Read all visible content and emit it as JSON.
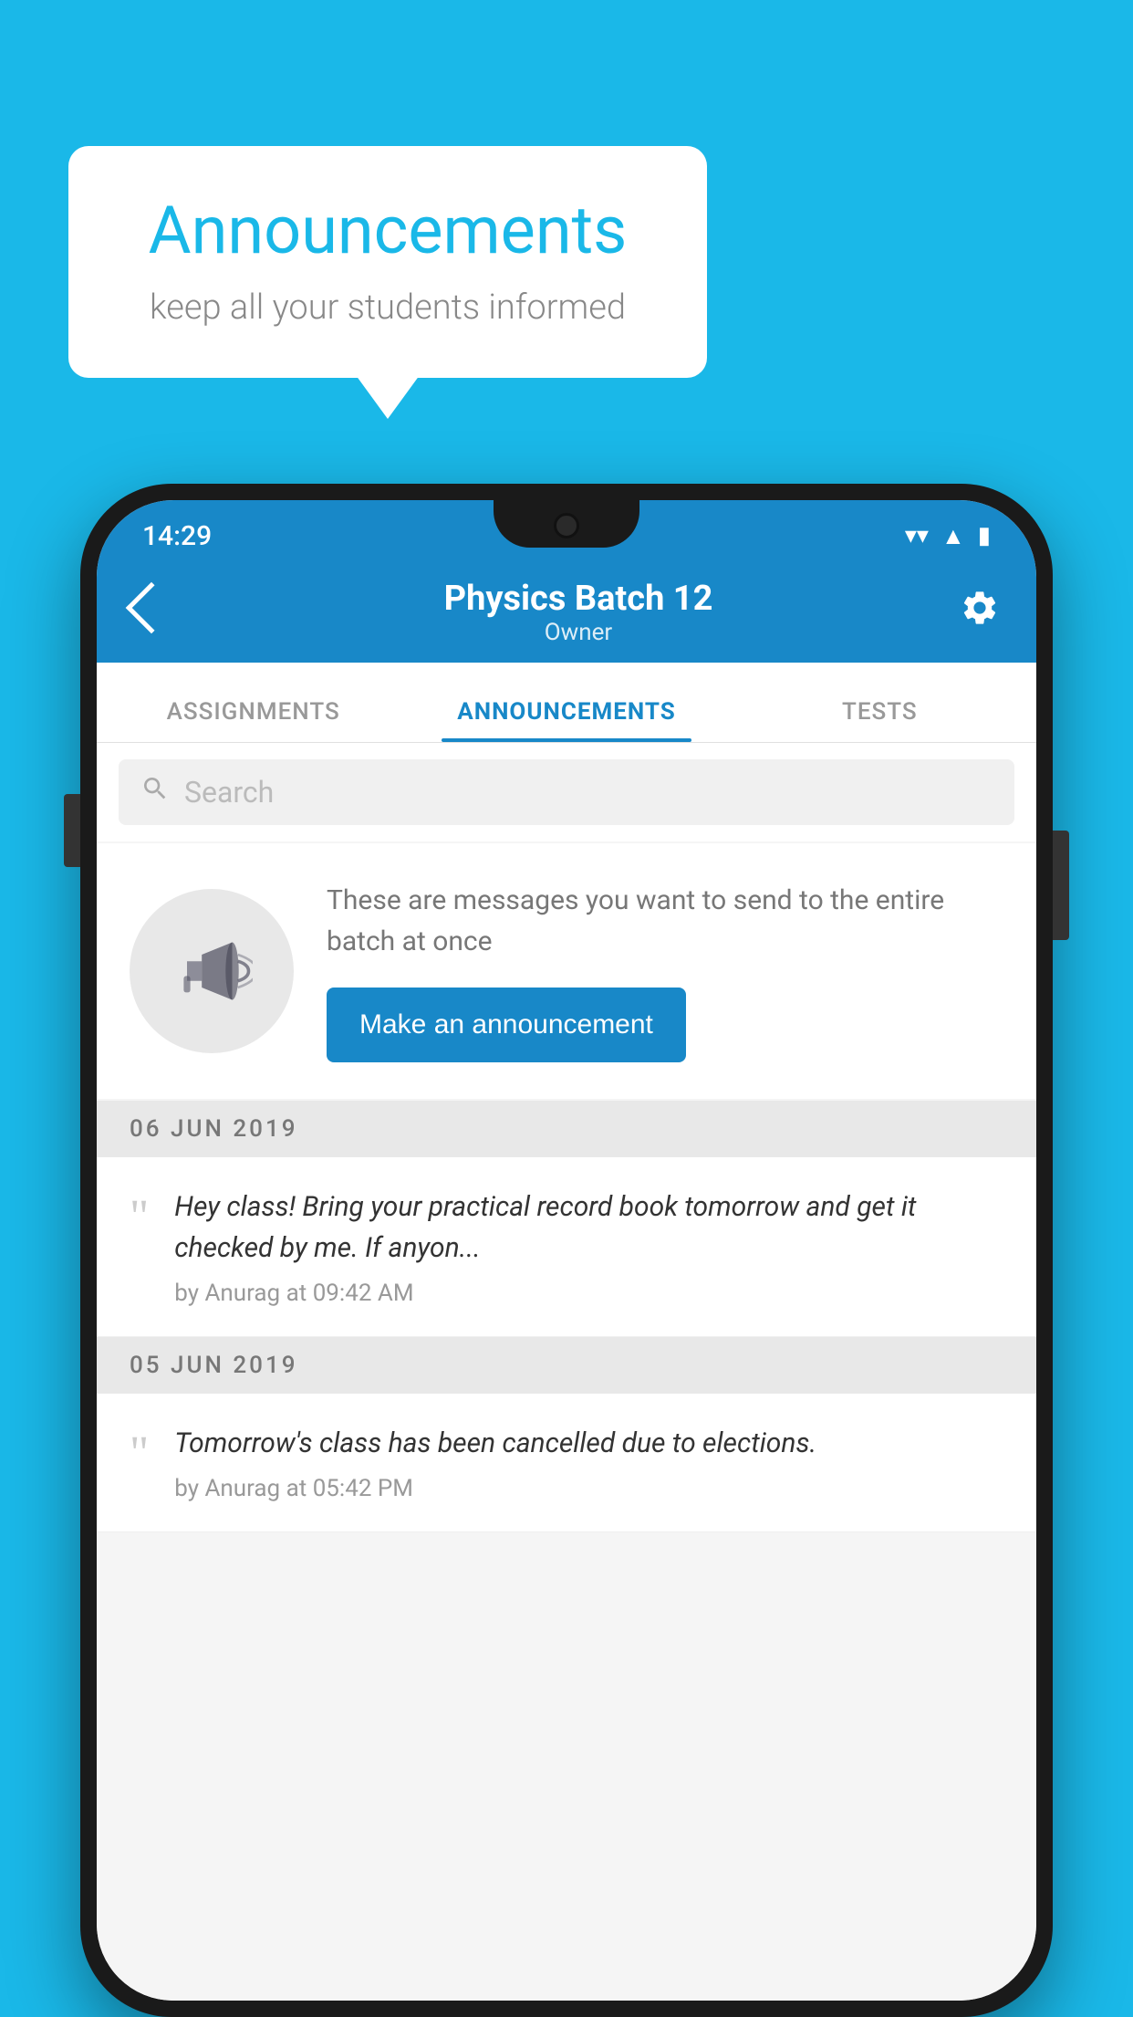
{
  "background_color": "#1ab8e8",
  "speech_bubble": {
    "title": "Announcements",
    "subtitle": "keep all your students informed"
  },
  "phone": {
    "status_bar": {
      "time": "14:29",
      "icons": [
        "wifi",
        "signal",
        "battery"
      ]
    },
    "app_bar": {
      "back_label": "←",
      "title": "Physics Batch 12",
      "subtitle": "Owner",
      "settings_label": "⚙"
    },
    "tabs": [
      {
        "label": "ASSIGNMENTS",
        "active": false
      },
      {
        "label": "ANNOUNCEMENTS",
        "active": true
      },
      {
        "label": "TESTS",
        "active": false
      }
    ],
    "search": {
      "placeholder": "Search"
    },
    "promo": {
      "description": "These are messages you want to send to the entire batch at once",
      "button_label": "Make an announcement"
    },
    "announcements": [
      {
        "date": "06  JUN  2019",
        "text": "Hey class! Bring your practical record book tomorrow and get it checked by me. If anyon...",
        "meta": "by Anurag at 09:42 AM"
      },
      {
        "date": "05  JUN  2019",
        "text": "Tomorrow's class has been cancelled due to elections.",
        "meta": "by Anurag at 05:42 PM"
      }
    ]
  }
}
